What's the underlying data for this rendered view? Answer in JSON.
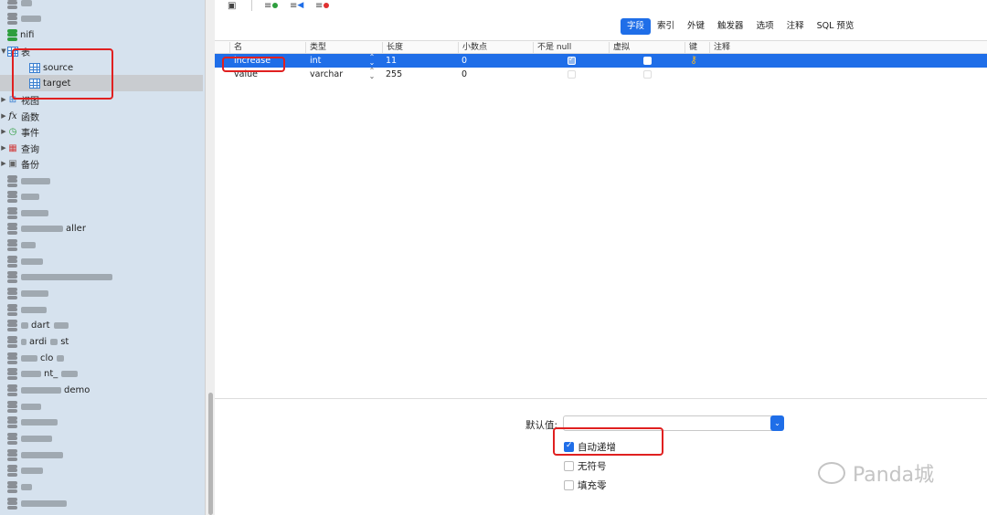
{
  "sidebar": {
    "db_nifi": "nifi",
    "tables_group": "表",
    "tables": [
      "source",
      "target"
    ],
    "views": "视图",
    "functions": "函数",
    "events": "事件",
    "queries": "查询",
    "backups": "备份",
    "partial_labels": {
      "a": "aller",
      "b": "ardi",
      "c": "st",
      "d": "clo",
      "e": "nt_",
      "f": "demo",
      "g": "dart"
    }
  },
  "tabs": [
    "字段",
    "索引",
    "外键",
    "触发器",
    "选项",
    "注释",
    "SQL 预览"
  ],
  "grid": {
    "headers": [
      "名",
      "类型",
      "长度",
      "小数点",
      "不是 null",
      "虚拟",
      "键",
      "注释"
    ],
    "rows": [
      {
        "name": "increase",
        "type": "int",
        "length": "11",
        "decimals": "0",
        "not_null": true,
        "virtual": false,
        "key": true
      },
      {
        "name": "value",
        "type": "varchar",
        "length": "255",
        "decimals": "0",
        "not_null": false,
        "virtual": false,
        "key": false
      }
    ]
  },
  "props": {
    "default_label": "默认值:",
    "default_value": "",
    "auto_increment": "自动递增",
    "unsigned": "无符号",
    "zerofill": "填充零"
  },
  "watermark": "Panda城",
  "colors": {
    "accent": "#1f6ee8",
    "highlight": "#e02020",
    "sidebar_bg": "#d6e2ee"
  }
}
